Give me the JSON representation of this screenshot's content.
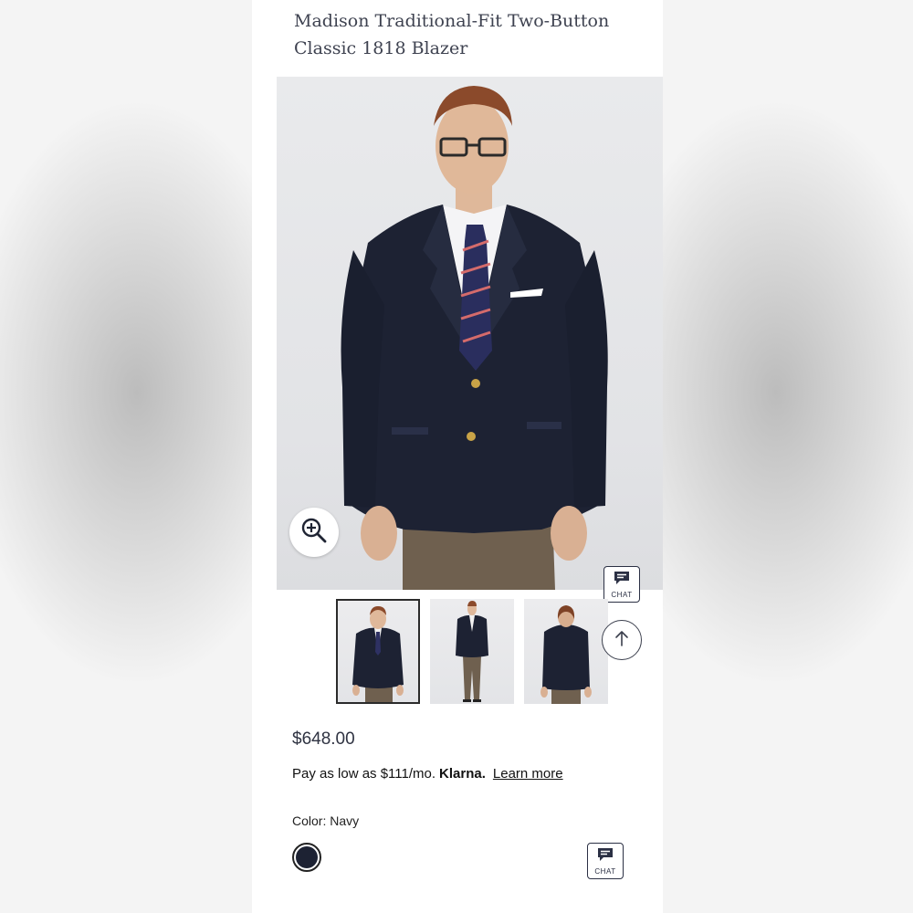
{
  "product": {
    "title": "Madison Traditional-Fit Two-Button Classic 1818 Blazer",
    "price": "$648.00",
    "klarna": {
      "pre": "Pay as low as $111/mo.",
      "brand": "Klarna.",
      "link": "Learn more"
    },
    "color_label": "Color:",
    "color_value": "Navy"
  },
  "chat": {
    "label": "CHAT"
  },
  "thumbnails": [
    {
      "view": "front-closeup",
      "selected": true
    },
    {
      "view": "front-full",
      "selected": false
    },
    {
      "view": "back",
      "selected": false
    }
  ],
  "icons": [
    "zoom-in-icon",
    "chat-icon",
    "arrow-up-icon"
  ],
  "colors": {
    "navy": "#1d2233",
    "title_text": "#3e4250",
    "trousers": "#6f604f"
  }
}
